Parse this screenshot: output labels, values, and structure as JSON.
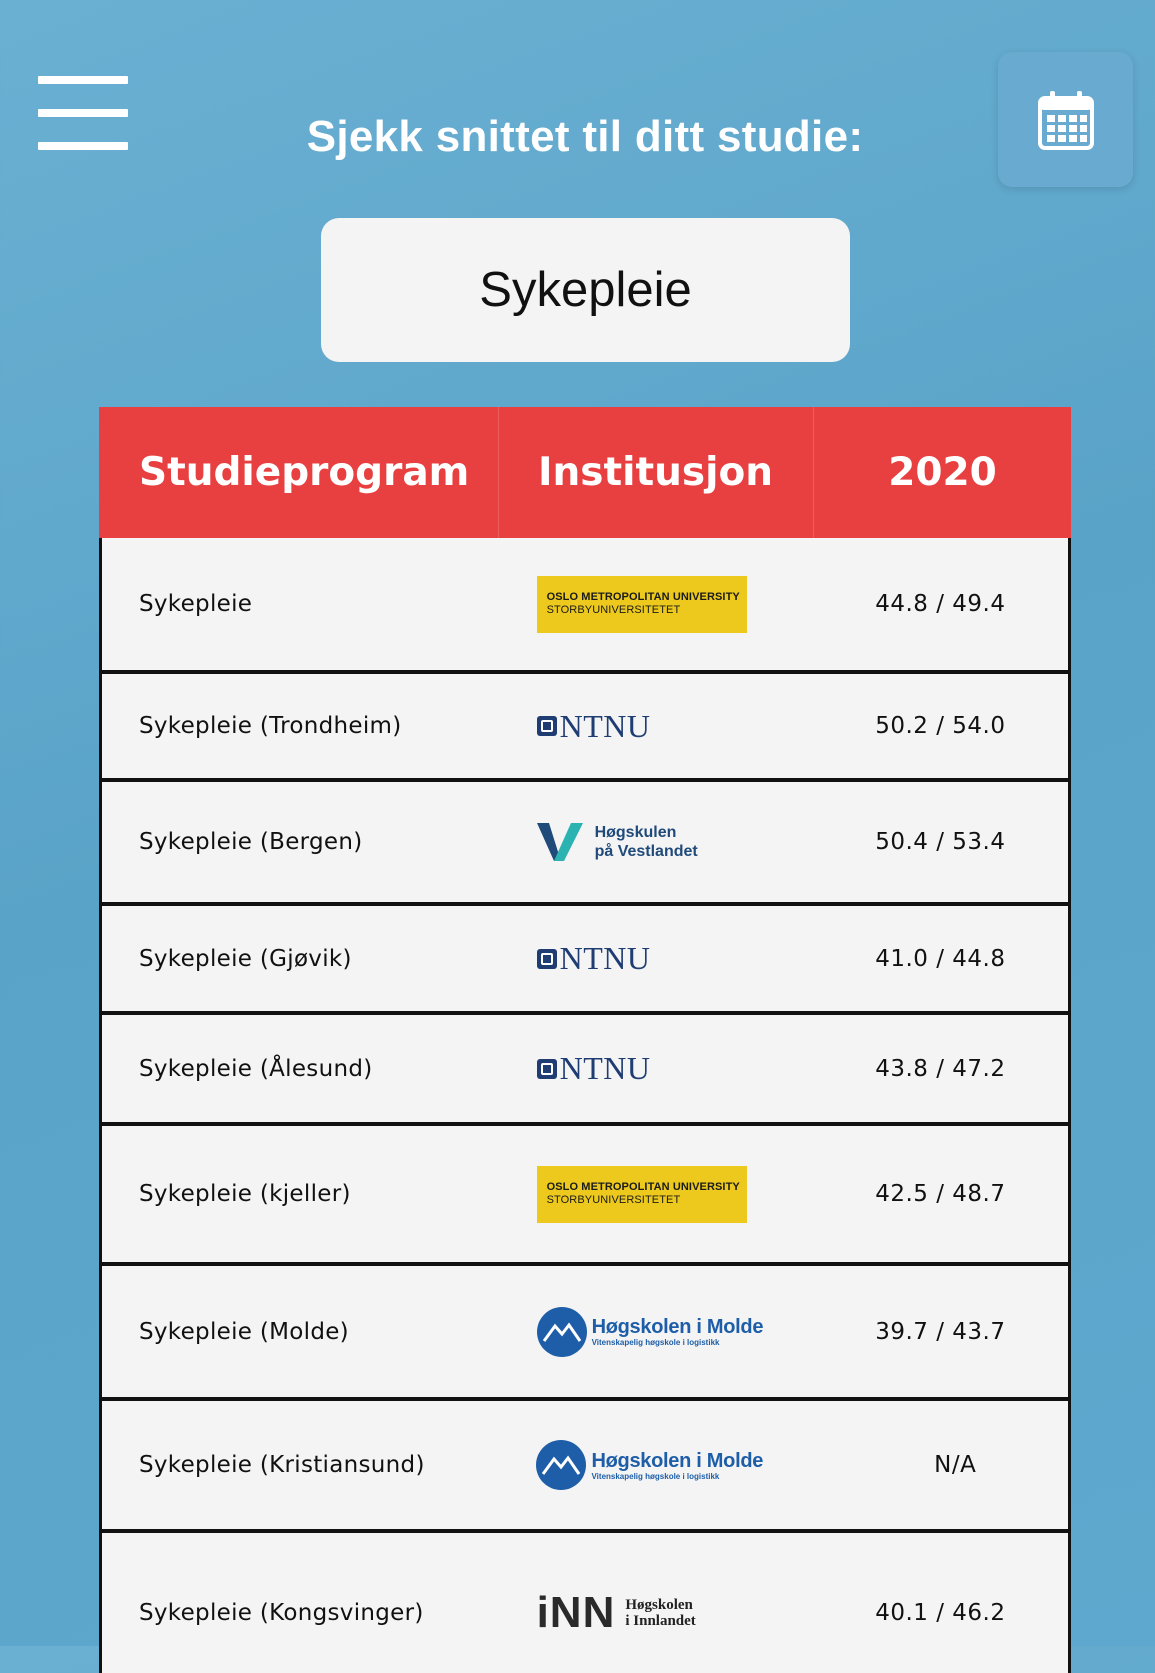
{
  "header": {
    "title": "Sjekk snittet til ditt studie:",
    "menu_icon": "hamburger-menu-icon",
    "calendar_icon": "calendar-icon"
  },
  "search": {
    "value": "Sykepleie"
  },
  "table": {
    "columns": [
      "Studieprogram",
      "Institusjon",
      "2020"
    ],
    "rows": [
      {
        "program": "Sykepleie",
        "institution": "OsloMet",
        "score": "44.8 / 49.4"
      },
      {
        "program": "Sykepleie (Trondheim)",
        "institution": "NTNU",
        "score": "50.2 / 54.0"
      },
      {
        "program": "Sykepleie (Bergen)",
        "institution": "HVL",
        "score": "50.4 / 53.4"
      },
      {
        "program": "Sykepleie (Gjøvik)",
        "institution": "NTNU",
        "score": "41.0 / 44.8"
      },
      {
        "program": "Sykepleie (Ålesund)",
        "institution": "NTNU",
        "score": "43.8 / 47.2"
      },
      {
        "program": "Sykepleie (kjeller)",
        "institution": "OsloMet",
        "score": "42.5 / 48.7"
      },
      {
        "program": "Sykepleie (Molde)",
        "institution": "HiMolde",
        "score": "39.7 / 43.7"
      },
      {
        "program": "Sykepleie (Kristiansund)",
        "institution": "HiMolde",
        "score": "N/A"
      },
      {
        "program": "Sykepleie (Kongsvinger)",
        "institution": "INN",
        "score": "40.1 / 46.2"
      }
    ]
  },
  "logos": {
    "oslomet": {
      "line1": "OSLO METROPOLITAN UNIVERSITY",
      "line2": "STORBYUNIVERSITETET"
    },
    "ntnu": {
      "text": "NTNU"
    },
    "hvl": {
      "line1": "Høgskulen",
      "line2": "på Vestlandet"
    },
    "himolde": {
      "line1": "Høgskolen i Molde",
      "line2": "Vitenskapelig høgskole i logistikk"
    },
    "inn": {
      "mark": "iNN",
      "line1": "Høgskolen",
      "line2": "i Innlandet"
    }
  },
  "colors": {
    "background": "#5ea8cf",
    "header_red": "#e84040",
    "oslomet_yellow": "#ecc91c",
    "ntnu_blue": "#1f3d73",
    "hvl_teal": "#2bb3b1",
    "himolde_blue": "#1e5ea8"
  }
}
